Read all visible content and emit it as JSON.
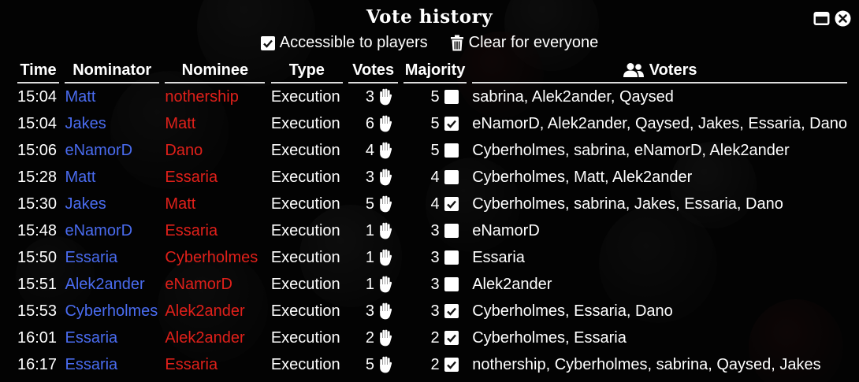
{
  "header": {
    "title": "Vote history",
    "options": [
      {
        "label": "Accessible to players",
        "icon": "checkbox-checked-icon"
      },
      {
        "label": "Clear for everyone",
        "icon": "trash-icon"
      }
    ]
  },
  "table": {
    "columns": {
      "time": "Time",
      "nominator": "Nominator",
      "nominee": "Nominee",
      "type": "Type",
      "votes": "Votes",
      "majority": "Majority",
      "voters": "Voters"
    },
    "rows": [
      {
        "time": "15:04",
        "nominator": "Matt",
        "nominee": "nothership",
        "type": "Execution",
        "votes": "3",
        "majority": "5",
        "passed": false,
        "voters": "sabrina, Alek2ander, Qaysed"
      },
      {
        "time": "15:04",
        "nominator": "Jakes",
        "nominee": "Matt",
        "type": "Execution",
        "votes": "6",
        "majority": "5",
        "passed": true,
        "voters": "eNamorD, Alek2ander, Qaysed, Jakes, Essaria, Dano"
      },
      {
        "time": "15:06",
        "nominator": "eNamorD",
        "nominee": "Dano",
        "type": "Execution",
        "votes": "4",
        "majority": "5",
        "passed": false,
        "voters": "Cyberholmes, sabrina, eNamorD, Alek2ander"
      },
      {
        "time": "15:28",
        "nominator": "Matt",
        "nominee": "Essaria",
        "type": "Execution",
        "votes": "3",
        "majority": "4",
        "passed": false,
        "voters": "Cyberholmes, Matt, Alek2ander"
      },
      {
        "time": "15:30",
        "nominator": "Jakes",
        "nominee": "Matt",
        "type": "Execution",
        "votes": "5",
        "majority": "4",
        "passed": true,
        "voters": "Cyberholmes, sabrina, Jakes, Essaria, Dano"
      },
      {
        "time": "15:48",
        "nominator": "eNamorD",
        "nominee": "Essaria",
        "type": "Execution",
        "votes": "1",
        "majority": "3",
        "passed": false,
        "voters": "eNamorD"
      },
      {
        "time": "15:50",
        "nominator": "Essaria",
        "nominee": "Cyberholmes",
        "type": "Execution",
        "votes": "1",
        "majority": "3",
        "passed": false,
        "voters": "Essaria"
      },
      {
        "time": "15:51",
        "nominator": "Alek2ander",
        "nominee": "eNamorD",
        "type": "Execution",
        "votes": "1",
        "majority": "3",
        "passed": false,
        "voters": "Alek2ander"
      },
      {
        "time": "15:53",
        "nominator": "Cyberholmes",
        "nominee": "Alek2ander",
        "type": "Execution",
        "votes": "3",
        "majority": "3",
        "passed": true,
        "voters": "Cyberholmes, Essaria, Dano"
      },
      {
        "time": "16:01",
        "nominator": "Essaria",
        "nominee": "Alek2ander",
        "type": "Execution",
        "votes": "2",
        "majority": "2",
        "passed": true,
        "voters": "Cyberholmes, Essaria"
      },
      {
        "time": "16:17",
        "nominator": "Essaria",
        "nominee": "Essaria",
        "type": "Execution",
        "votes": "5",
        "majority": "2",
        "passed": true,
        "voters": "nothership, Cyberholmes, sabrina, Qaysed, Jakes"
      }
    ]
  },
  "colors": {
    "nominator": "#4a6cf0",
    "nominee": "#e0201a",
    "text": "#ffffff"
  },
  "icons": {
    "votes": "hand-icon",
    "voters": "users-icon",
    "maximize": "window-maximize-icon",
    "close": "close-icon"
  }
}
